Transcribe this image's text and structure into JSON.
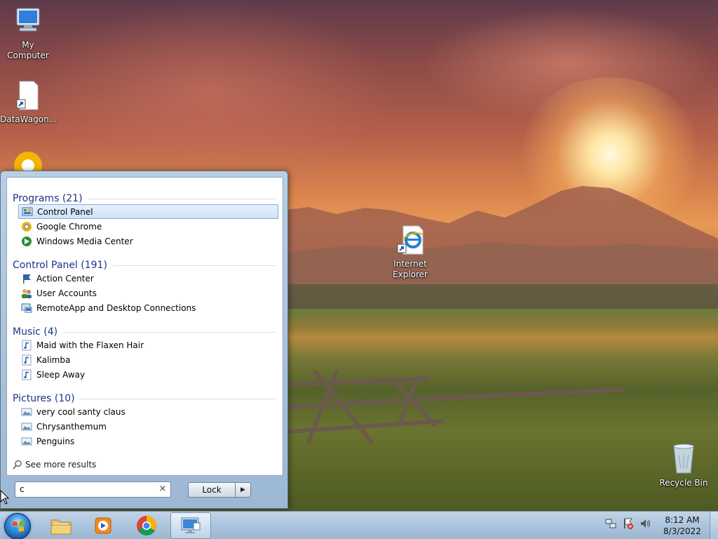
{
  "desktop": {
    "icons": [
      {
        "label": "My Computer"
      },
      {
        "label": "DataWagon..."
      },
      {
        "label": "Internet\nExplorer"
      },
      {
        "label": "Recycle Bin"
      }
    ]
  },
  "start_menu": {
    "groups": [
      {
        "header": "Programs (21)",
        "items": [
          {
            "label": "Control Panel",
            "icon": "control-panel-icon",
            "selected": true
          },
          {
            "label": "Google Chrome",
            "icon": "chrome-icon"
          },
          {
            "label": "Windows Media Center",
            "icon": "media-center-icon"
          }
        ]
      },
      {
        "header": "Control Panel (191)",
        "items": [
          {
            "label": "Action Center",
            "icon": "flag-icon"
          },
          {
            "label": "User Accounts",
            "icon": "users-icon"
          },
          {
            "label": "RemoteApp and Desktop Connections",
            "icon": "remote-desktop-icon"
          }
        ]
      },
      {
        "header": "Music (4)",
        "items": [
          {
            "label": "Maid with the Flaxen Hair",
            "icon": "music-file-icon"
          },
          {
            "label": "Kalimba",
            "icon": "music-file-icon"
          },
          {
            "label": "Sleep Away",
            "icon": "music-file-icon"
          }
        ]
      },
      {
        "header": "Pictures (10)",
        "items": [
          {
            "label": "very cool santy claus",
            "icon": "picture-file-icon"
          },
          {
            "label": "Chrysanthemum",
            "icon": "picture-file-icon"
          },
          {
            "label": "Penguins",
            "icon": "picture-file-icon"
          }
        ]
      }
    ],
    "see_more": "See more results",
    "search_value": "c",
    "clear_glyph": "×",
    "lock_label": "Lock",
    "lock_arrow": "▶"
  },
  "taskbar": {
    "pinned": [
      "file-explorer-icon",
      "media-player-icon",
      "chrome-icon",
      "remote-desktop-icon"
    ],
    "clock_time": "8:12 AM",
    "clock_date": "8/3/2022"
  },
  "colors": {
    "group_header": "#1e3287",
    "selection_border": "#84acdd"
  }
}
